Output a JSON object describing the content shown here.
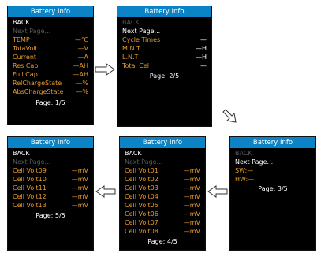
{
  "screens": [
    {
      "title": "Battery Info",
      "back": "BACK",
      "next": "Next Page...",
      "items": [
        {
          "label": "TEMP",
          "value": "—℃"
        },
        {
          "label": "TotaVolt",
          "value": "—V"
        },
        {
          "label": "Current",
          "value": "—A"
        },
        {
          "label": "Res Cap",
          "value": "—AH"
        },
        {
          "label": "Full Cap",
          "value": "—AH"
        },
        {
          "label": "RelChargeState",
          "value": "—%"
        },
        {
          "label": "AbsChargeState",
          "value": "—%"
        }
      ],
      "page": "Page: 1/5"
    },
    {
      "title": "Battery Info",
      "back": "BACK",
      "next": "Next Page...",
      "items": [
        {
          "label": "Cycle Times",
          "value": "—"
        },
        {
          "label": "M.N.T",
          "value": "—H"
        },
        {
          "label": "L.N.T",
          "value": "—H"
        },
        {
          "label": "Total Cel",
          "value": "—"
        }
      ],
      "page": "Page: 2/5"
    },
    {
      "title": "Battery Info",
      "back": "BACK",
      "next": "Next Page...",
      "items": [
        {
          "label": "SW:—",
          "value": ""
        },
        {
          "label": "HW:—",
          "value": ""
        }
      ],
      "page": "Page: 3/5"
    },
    {
      "title": "Battery Info",
      "back": "BACK",
      "next": "Next Page...",
      "items": [
        {
          "label": "Cell Volt01",
          "value": "—mV"
        },
        {
          "label": "Cell Volt02",
          "value": "—mV"
        },
        {
          "label": "Cell Volt03",
          "value": "—mV"
        },
        {
          "label": "Cell Volt04",
          "value": "—mV"
        },
        {
          "label": "Cell Volt05",
          "value": "—mV"
        },
        {
          "label": "Cell Volt06",
          "value": "—mV"
        },
        {
          "label": "Cell Volt07",
          "value": "—mV"
        },
        {
          "label": "Cell Volt08",
          "value": "—mV"
        }
      ],
      "page": "Page: 4/5"
    },
    {
      "title": "Battery Info",
      "back": "BACK",
      "next": "Next Page...",
      "items": [
        {
          "label": "Cell Volt09",
          "value": "—mV"
        },
        {
          "label": "Cell Volt10",
          "value": "—mV"
        },
        {
          "label": "Cell Volt11",
          "value": "—mV"
        },
        {
          "label": "Cell Volt12",
          "value": "—mV"
        },
        {
          "label": "Cell Volt13",
          "value": "—mV"
        }
      ],
      "page": "Page: 5/5"
    }
  ],
  "colors": {
    "header": "#0a84c6",
    "label_highlight": "#e99a2a",
    "dimmed": "#5a5a5a",
    "background": "#000000"
  }
}
